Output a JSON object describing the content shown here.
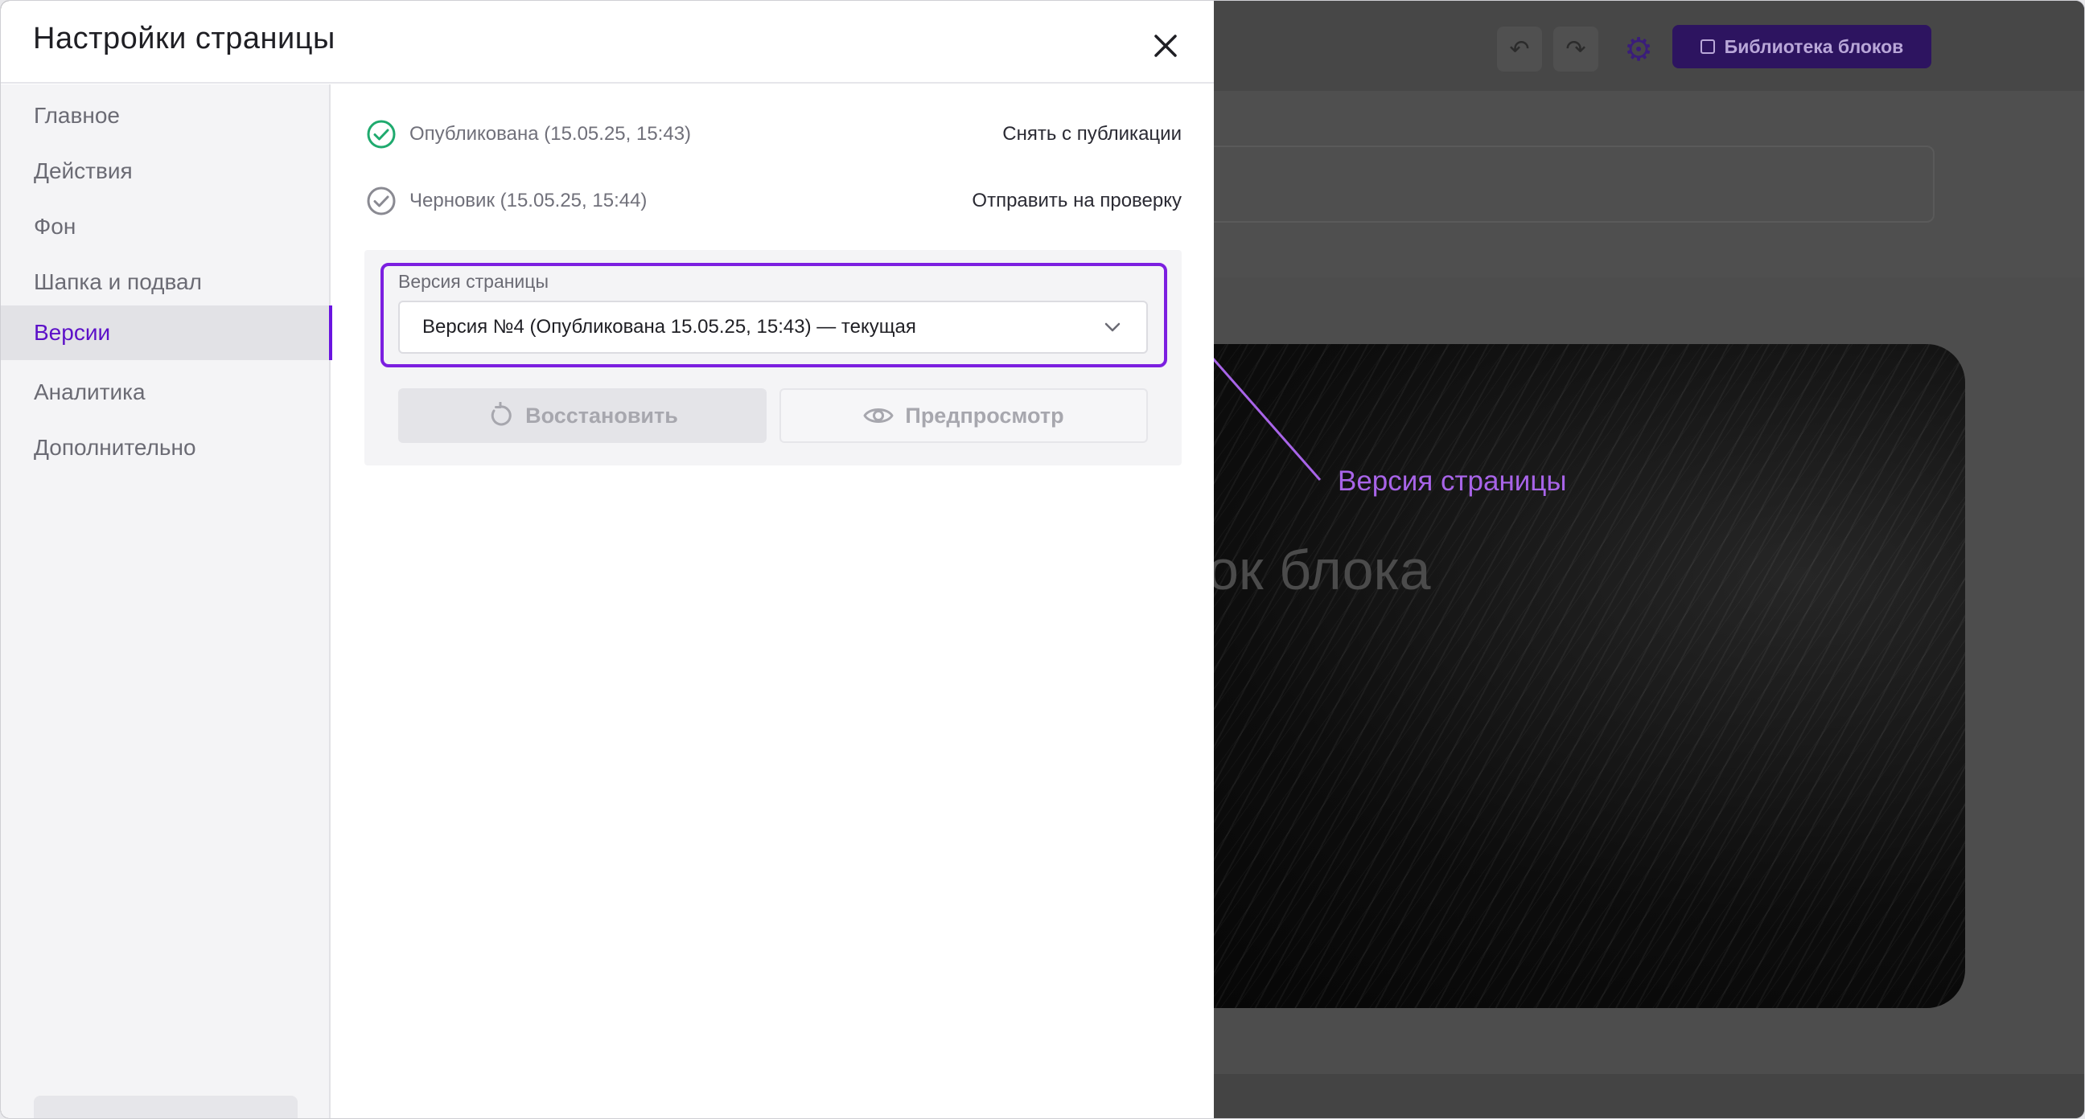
{
  "modal": {
    "title": "Настройки страницы",
    "close_icon": "close-icon"
  },
  "sidebar": {
    "items": [
      {
        "label": "Главное"
      },
      {
        "label": "Действия"
      },
      {
        "label": "Фон"
      },
      {
        "label": "Шапка и подвал"
      },
      {
        "label": "Версии",
        "active": true
      },
      {
        "label": "Аналитика"
      },
      {
        "label": "Дополнительно"
      }
    ]
  },
  "status": {
    "published": {
      "text": "Опубликована (15.05.25, 15:43)",
      "action": "Снять с публикации",
      "icon": "check-circle-icon",
      "color": "#1faa6e"
    },
    "draft": {
      "text": "Черновик (15.05.25, 15:44)",
      "action": "Отправить на проверку",
      "icon": "check-circle-icon",
      "color": "#8a8a92"
    }
  },
  "version": {
    "label": "Версия страницы",
    "selected": "Версия №4 (Опубликована 15.05.25, 15:43) — текущая",
    "restore_label": "Восстановить",
    "preview_label": "Предпросмотр",
    "highlight_color": "#7c1fe0"
  },
  "callout": {
    "text": "Версия страницы",
    "color": "#a864e8"
  },
  "editor": {
    "library_button": "Библиотека блоков",
    "hero_title": "ок блока",
    "accent": "#2d1460"
  }
}
